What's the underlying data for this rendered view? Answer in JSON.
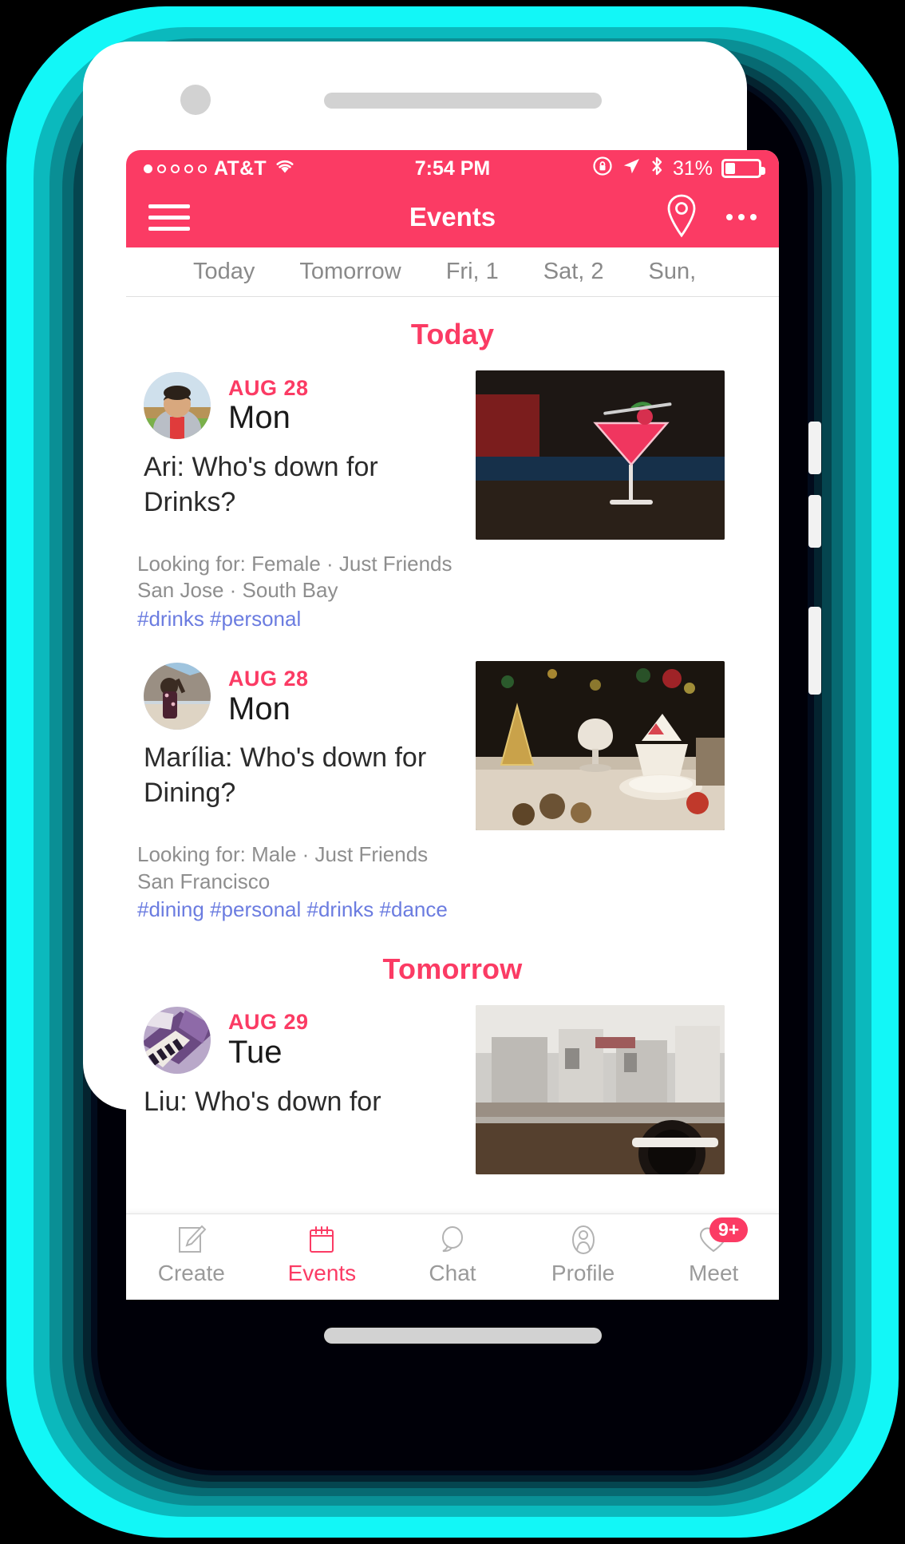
{
  "status_bar": {
    "carrier": "AT&T",
    "signal_dots_total": 5,
    "signal_dots_filled": 1,
    "wifi_icon": "wifi-icon",
    "time": "7:54 PM",
    "rotation_lock_icon": "rotation-lock-icon",
    "location_icon": "location-arrow-icon",
    "bluetooth_icon": "bluetooth-icon",
    "battery_percent": "31%",
    "battery_level": 31
  },
  "nav_bar": {
    "menu_icon": "hamburger-menu-icon",
    "title": "Events",
    "location_pin_icon": "map-pin-icon",
    "overflow_icon": "more-options-icon"
  },
  "date_tabs": [
    {
      "label": "Today",
      "selected": true
    },
    {
      "label": "Tomorrow",
      "selected": false
    },
    {
      "label": "Fri, 1",
      "selected": false
    },
    {
      "label": "Sat, 2",
      "selected": false
    },
    {
      "label": "Sun,",
      "selected": false
    }
  ],
  "sections": [
    {
      "heading": "Today",
      "events": [
        {
          "month_day": "AUG 28",
          "weekday": "Mon",
          "title": "Ari: Who's down for Drinks?",
          "looking_for": "Looking for: Female · Just Friends",
          "location": "San Jose · South Bay",
          "hashtags": "#drinks #personal",
          "avatar_name": "avatar-ari",
          "photo_name": "event-photo-cocktail"
        },
        {
          "month_day": "AUG 28",
          "weekday": "Mon",
          "title": "Marília: Who's down for Dining?",
          "looking_for": "Looking for: Male · Just Friends",
          "location": "San Francisco",
          "hashtags": "#dining #personal #drinks #dance",
          "avatar_name": "avatar-marilia",
          "photo_name": "event-photo-dining-table"
        }
      ]
    },
    {
      "heading": "Tomorrow",
      "events": [
        {
          "month_day": "AUG 29",
          "weekday": "Tue",
          "title": "Liu: Who's down for",
          "looking_for": "",
          "location": "",
          "hashtags": "",
          "avatar_name": "avatar-liu",
          "photo_name": "event-photo-cafe"
        }
      ]
    }
  ],
  "tab_bar": [
    {
      "label": "Create",
      "icon": "compose-icon",
      "active": false,
      "badge": ""
    },
    {
      "label": "Events",
      "icon": "calendar-icon",
      "active": true,
      "badge": ""
    },
    {
      "label": "Chat",
      "icon": "chat-bubble-icon",
      "active": false,
      "badge": ""
    },
    {
      "label": "Profile",
      "icon": "person-icon",
      "active": false,
      "badge": ""
    },
    {
      "label": "Meet",
      "icon": "heart-icon",
      "active": false,
      "badge": "9+"
    }
  ],
  "colors": {
    "accent_pink": "#fb3b64",
    "hashtag_blue": "#6b7ce0",
    "muted_gray": "#8e8e8e",
    "glow_cyan": "#12f7f7"
  }
}
